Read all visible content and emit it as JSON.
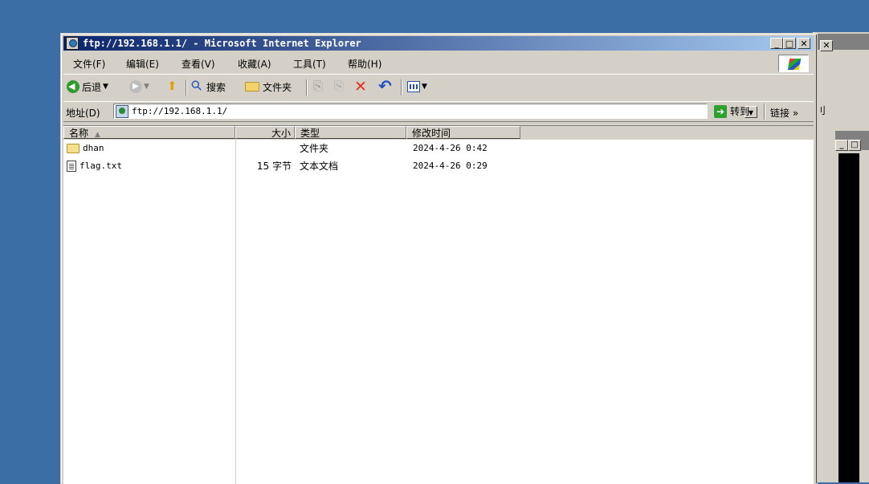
{
  "window": {
    "title": "ftp://192.168.1.1/ - Microsoft Internet Explorer",
    "min_glyph": "_",
    "max_glyph": "□",
    "close_glyph": "✕"
  },
  "menu": [
    "文件(F)",
    "编辑(E)",
    "查看(V)",
    "收藏(A)",
    "工具(T)",
    "帮助(H)"
  ],
  "toolbar": {
    "back_label": "后退",
    "search_label": "搜索",
    "folders_label": "文件夹"
  },
  "address": {
    "label": "地址(D)",
    "value": "ftp://192.168.1.1/",
    "go_label": "转到",
    "links_label": "链接 »"
  },
  "columns": {
    "name": "名称",
    "size": "大小",
    "type": "类型",
    "modified": "修改时间"
  },
  "files": [
    {
      "name": "dhan",
      "icon": "folder-icon",
      "size": "",
      "type": "文件夹",
      "modified": "2024-4-26 0:42"
    },
    {
      "name": "flag.txt",
      "icon": "text-file-icon",
      "size": "15 字节",
      "type": "文本文档",
      "modified": "2024-4-26 0:29"
    }
  ],
  "background": {
    "right_window_fragment": "刂",
    "colors": {
      "desktop": "#3a6ea5",
      "titlebar_start": "#0a246a",
      "titlebar_end": "#a6caf0",
      "chrome": "#d4d0c8"
    }
  }
}
